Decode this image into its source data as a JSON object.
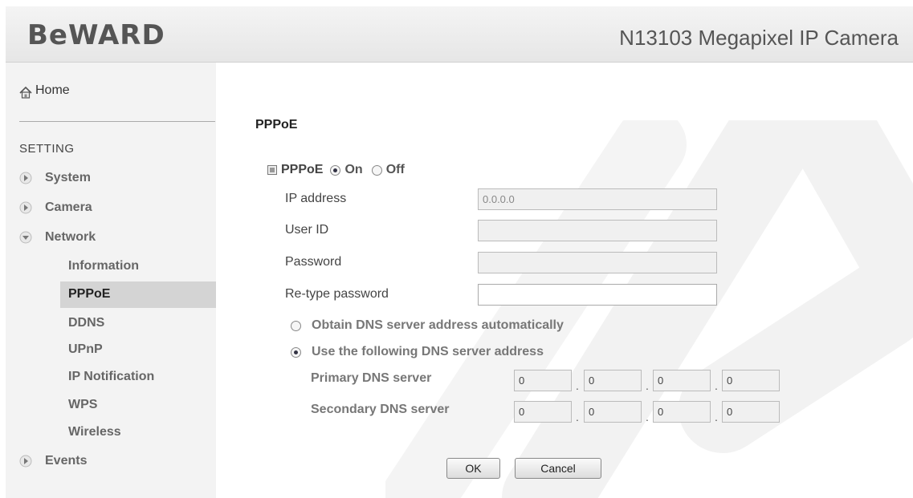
{
  "header": {
    "logo": "BeWARD",
    "camera_title": "N13103 Megapixel IP Camera"
  },
  "sidebar": {
    "home_label": "Home",
    "section_label": "SETTING",
    "menu": {
      "system": "System",
      "camera": "Camera",
      "network": "Network",
      "events": "Events"
    },
    "network_items": [
      "Information",
      "PPPoE",
      "DDNS",
      "UPnP",
      "IP Notification",
      "WPS",
      "Wireless"
    ],
    "active_item": "PPPoE"
  },
  "main": {
    "page_title": "PPPoE",
    "pppoe": {
      "label": "PPPoE",
      "on_label": "On",
      "off_label": "Off",
      "selected": "On"
    },
    "fields": {
      "ip_label": "IP address",
      "ip_value": "0.0.0.0",
      "user_label": "User ID",
      "user_value": "",
      "password_label": "Password",
      "password_value": "",
      "retype_label": "Re-type password",
      "retype_value": ""
    },
    "dns": {
      "auto_label": "Obtain DNS server address automatically",
      "manual_label": "Use the following DNS server address",
      "selected": "manual",
      "primary_label": "Primary DNS server",
      "primary": [
        "0",
        "0",
        "0",
        "0"
      ],
      "secondary_label": "Secondary DNS server",
      "secondary": [
        "0",
        "0",
        "0",
        "0"
      ],
      "separator": "."
    },
    "buttons": {
      "ok": "OK",
      "cancel": "Cancel"
    }
  }
}
